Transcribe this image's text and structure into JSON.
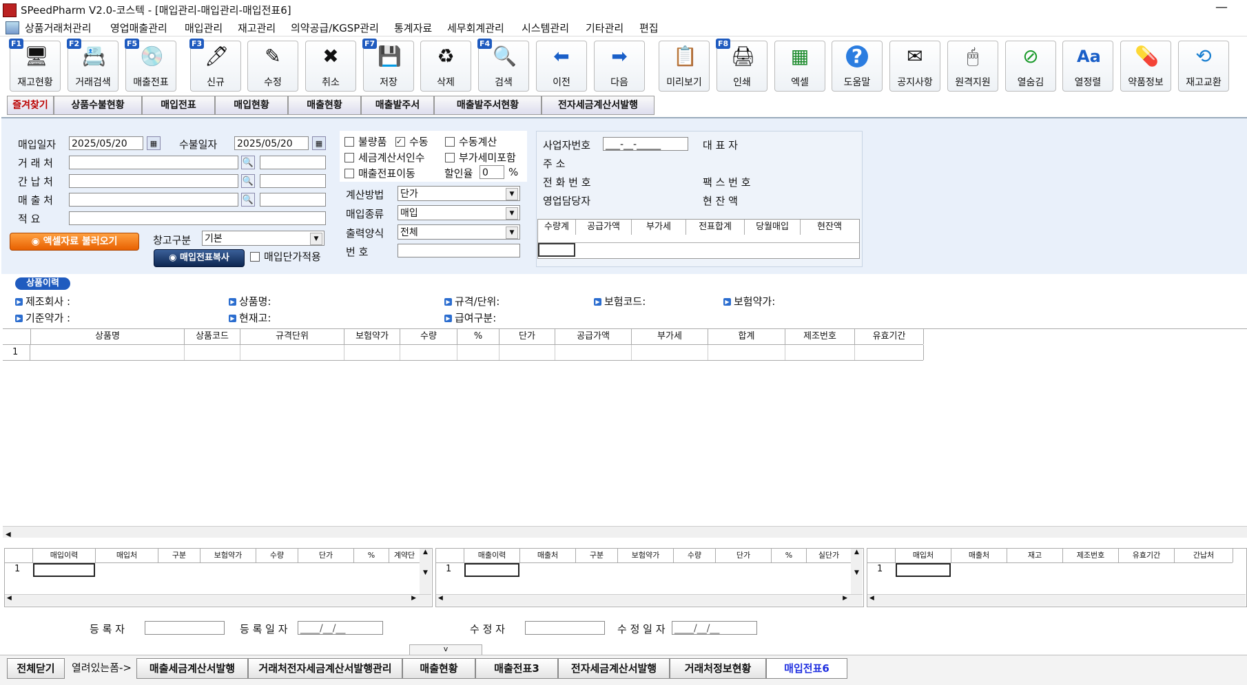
{
  "window": {
    "title": "SPeedPharm V2.0-코스텍 - [매입관리-매입관리-매입전표6]",
    "min": "—"
  },
  "menu": [
    "상품거래처관리",
    "영업매출관리",
    "매입관리",
    "재고관리",
    "의약공급/KGSP관리",
    "통계자료",
    "세무회계관리",
    "시스템관리",
    "기타관리",
    "편집"
  ],
  "toolbar": [
    {
      "label": "재고현황",
      "fkey": "F1",
      "icon": "🖥"
    },
    {
      "label": "거래검색",
      "fkey": "F2",
      "icon": "📇"
    },
    {
      "label": "매출전표",
      "fkey": "F5",
      "icon": "💿"
    },
    {
      "label": "신규",
      "fkey": "F3",
      "icon": "🖊"
    },
    {
      "label": "수정",
      "fkey": "",
      "icon": "✎"
    },
    {
      "label": "취소",
      "fkey": "",
      "icon": "✖"
    },
    {
      "label": "저장",
      "fkey": "F7",
      "icon": "💾"
    },
    {
      "label": "삭제",
      "fkey": "",
      "icon": "♻"
    },
    {
      "label": "검색",
      "fkey": "F4",
      "icon": "🔍"
    },
    {
      "label": "이전",
      "fkey": "",
      "icon": "⬅"
    },
    {
      "label": "다음",
      "fkey": "",
      "icon": "➡"
    },
    {
      "label": "미리보기",
      "fkey": "",
      "icon": "📋"
    },
    {
      "label": "인쇄",
      "fkey": "F8",
      "icon": "🖨"
    },
    {
      "label": "엑셀",
      "fkey": "",
      "icon": "▦"
    },
    {
      "label": "도움말",
      "fkey": "",
      "icon": "?"
    },
    {
      "label": "공지사항",
      "fkey": "",
      "icon": "✉"
    },
    {
      "label": "원격지원",
      "fkey": "",
      "icon": "🖱"
    },
    {
      "label": "열숨김",
      "fkey": "",
      "icon": "⊘"
    },
    {
      "label": "열정렬",
      "fkey": "",
      "icon": "Aa"
    },
    {
      "label": "약품정보",
      "fkey": "",
      "icon": "💊"
    },
    {
      "label": "재고교환",
      "fkey": "",
      "icon": "⟲"
    }
  ],
  "tabs": [
    "즐겨찾기",
    "상품수불현황",
    "매입전표",
    "매입현황",
    "매출현황",
    "매출발주서",
    "매출발주서현황",
    "전자세금계산서발행"
  ],
  "form": {
    "purchase_date_label": "매입일자",
    "purchase_date": "2025/05/20",
    "receipt_date_label": "수불일자",
    "receipt_date": "2025/05/20",
    "vendor_label": "거 래 처",
    "intermediary_label": "간 납 처",
    "sales_label": "매 출 처",
    "memo_label": "적    요",
    "excel_button": "액셀자료 불러오기",
    "warehouse_label": "창고구분",
    "warehouse_value": "기본",
    "copy_button": "매입전표복사",
    "unit_price_apply": "매입단가적용",
    "cb_defect": "불량품",
    "cb_manual": "수동",
    "cb_manual_calc": "수동계산",
    "cb_tax_invoice": "세금계산서인수",
    "cb_vat_excl": "부가세미포함",
    "cb_sales_move": "매출전표이동",
    "discount_label": "할인율",
    "discount_value": "0",
    "percent": "%",
    "calc_method_label": "계산방법",
    "calc_method": "단가",
    "purchase_type_label": "매입종류",
    "purchase_type": "매입",
    "output_format_label": "출력양식",
    "output_format": "전체",
    "number_label": "번    호"
  },
  "vendor_panel": {
    "biz_no_label": "사업자번호",
    "biz_no": "___-__-_____",
    "rep_label": "대  표  자",
    "address_label": "주        소",
    "phone_label": "전 화 번 호",
    "fax_label": "팩 스 번 호",
    "sales_rep_label": "영업담당자",
    "balance_label": "현  잔  액",
    "cols": [
      "수량계",
      "공급가액",
      "부가세",
      "전표합계",
      "당월매입",
      "현잔액"
    ]
  },
  "product_history": {
    "badge": "상품이력",
    "fields": [
      "제조회사 :",
      "상품명:",
      "규격/단위:",
      "보험코드:",
      "보험약가:",
      "기준약가 :",
      "현재고:",
      "급여구분:"
    ]
  },
  "main_grid": {
    "cols": [
      "상품명",
      "상품코드",
      "규격단위",
      "보험약가",
      "수량",
      "%",
      "단가",
      "공급가액",
      "부가세",
      "합계",
      "제조번호",
      "유효기간"
    ],
    "row1": "1"
  },
  "grid_a": {
    "cols": [
      "매입이력",
      "매입처",
      "구분",
      "보험약가",
      "수량",
      "단가",
      "%",
      "계약단"
    ],
    "row1": "1"
  },
  "grid_b": {
    "cols": [
      "매출이력",
      "매출처",
      "구분",
      "보험약가",
      "수량",
      "단가",
      "%",
      "실단가"
    ],
    "row1": "1"
  },
  "grid_c": {
    "cols": [
      "매입처",
      "매출처",
      "재고",
      "제조번호",
      "유효기간",
      "간납처"
    ],
    "row1": "1"
  },
  "footer": {
    "reg_user_label": "등    록    자",
    "reg_date_label": "등 록 일 자",
    "reg_date": "____/__/__",
    "mod_user_label": "수    정    자",
    "mod_date_label": "수 정 일 자",
    "mod_date": "____/__/__",
    "collapse": "v"
  },
  "bottom_tabs": {
    "close_all": "전체닫기",
    "open_label": "열려있는폼->",
    "tabs": [
      "매출세금계산서발행",
      "거래처전자세금계산서발행관리",
      "매출현황",
      "매출전표3",
      "전자세금계산서발행",
      "거래처정보현황",
      "매입전표6"
    ]
  },
  "colors": {
    "accent": "#1f5bbf",
    "active_tab": "#1f2fe0"
  }
}
